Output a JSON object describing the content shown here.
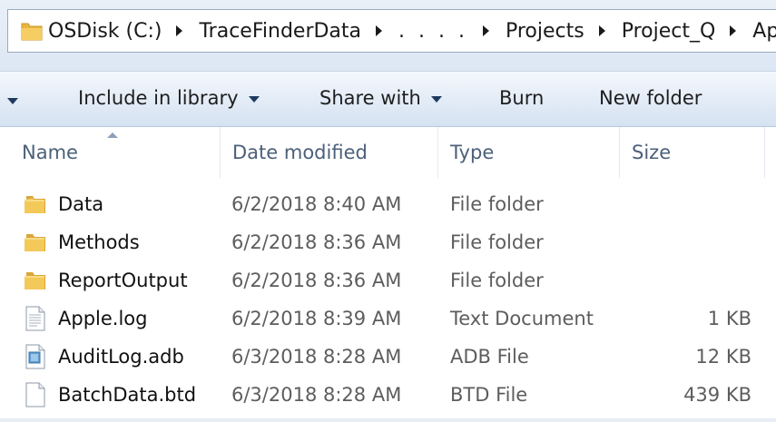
{
  "address_bar": {
    "crumbs": [
      "OSDisk (C:)",
      "TraceFinderData",
      ". . . .",
      "Projects",
      "Project_Q",
      "Apple"
    ]
  },
  "command_bar": {
    "include_in_library": "Include in library",
    "share_with": "Share with",
    "burn": "Burn",
    "new_folder": "New folder"
  },
  "columns": {
    "name": "Name",
    "date_modified": "Date modified",
    "type": "Type",
    "size": "Size"
  },
  "files": [
    {
      "name": "Data",
      "date": "6/2/2018 8:40 AM",
      "type": "File folder",
      "size": "",
      "icon": "folder-icon"
    },
    {
      "name": "Methods",
      "date": "6/2/2018 8:36 AM",
      "type": "File folder",
      "size": "",
      "icon": "folder-icon"
    },
    {
      "name": "ReportOutput",
      "date": "6/2/2018 8:36 AM",
      "type": "File folder",
      "size": "",
      "icon": "folder-icon"
    },
    {
      "name": "Apple.log",
      "date": "6/2/2018 8:39 AM",
      "type": "Text Document",
      "size": "1 KB",
      "icon": "text-document-icon"
    },
    {
      "name": "AuditLog.adb",
      "date": "6/3/2018 8:28 AM",
      "type": "ADB File",
      "size": "12 KB",
      "icon": "adb-file-icon"
    },
    {
      "name": "BatchData.btd",
      "date": "6/3/2018 8:28 AM",
      "type": "BTD File",
      "size": "439 KB",
      "icon": "blank-file-icon"
    }
  ],
  "colors": {
    "folder": "#f0c456",
    "header_text": "#4c607a",
    "command_bar": "#dce6f3"
  }
}
